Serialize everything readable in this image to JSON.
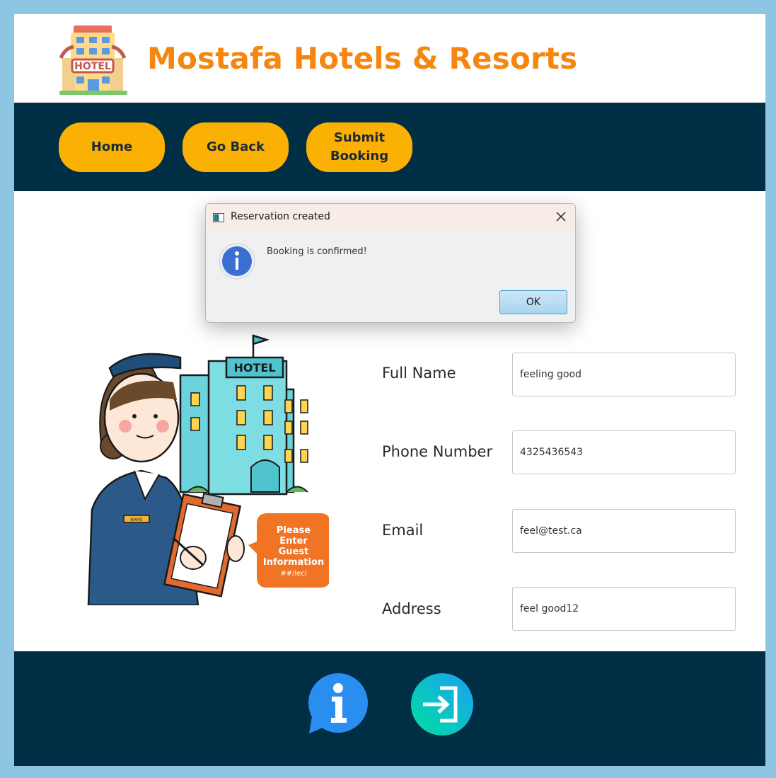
{
  "header": {
    "brand_title": "Mostafa Hotels & Resorts",
    "logo_sign_text": "HOTEL",
    "brand_color": "#f5860f"
  },
  "nav": {
    "home_label": "Home",
    "go_back_label": "Go Back",
    "submit_booking_label": "Submit Booking",
    "button_color": "#fbb103",
    "bar_color": "#002e45"
  },
  "illustration": {
    "building_sign": "HOTEL",
    "badge_text": "NAME",
    "speech_bubble": [
      "Please",
      "Enter",
      "Guest",
      "Information",
      "##/lecl"
    ]
  },
  "form": {
    "full_name": {
      "label": "Full Name",
      "value": "feeling good"
    },
    "phone_number": {
      "label": "Phone Number",
      "value": "4325436543"
    },
    "email": {
      "label": "Email",
      "value": "feel@test.ca"
    },
    "address": {
      "label": "Address",
      "value": "feel good12"
    }
  },
  "footer": {
    "info_icon": "info-chat-icon",
    "login_icon": "login-icon"
  },
  "dialog": {
    "title": "Reservation created",
    "message": "Booking is confirmed!",
    "ok_label": "OK",
    "icon": "information-icon"
  }
}
